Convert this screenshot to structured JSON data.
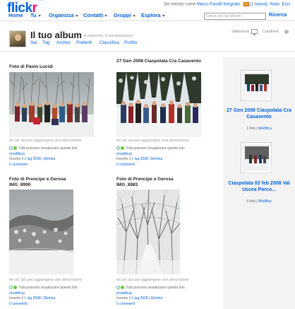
{
  "header": {
    "logo_main": "flick",
    "logo_r": "r",
    "logo_tm": "TM",
    "signed_in_prefix": "Sei entrato come",
    "user": "Marco Favalli fotografo",
    "new_mail": "(1 nuova)",
    "help": "Aiuto",
    "logout": "Esci"
  },
  "nav": {
    "items": [
      "Home",
      "Tu",
      "Organizza",
      "Contatti",
      "Gruppi",
      "Esplora"
    ],
    "search_placeholder": "Cerca nel tuo album",
    "search_button": "Ricerca"
  },
  "album": {
    "title": "Il tuo album",
    "stats": "8 elementi / 0 visualizzazioni",
    "subnav": [
      "Set",
      "Tag",
      "Archivi",
      "Preferiti",
      "Classifica",
      "Profilo"
    ],
    "slideshow": "Slideshow",
    "share": "Condividi"
  },
  "photos": [
    {
      "title": "Foto di Paolo Lucidi",
      "description": "fai clic qui per aggiungere una descrizione",
      "privacy": "Tutti possono visualizzare questa foto",
      "edit": "(modifica)",
      "uploaded_prefix": "Inserito il",
      "date": "1 lug 2008",
      "delete": "Elimina",
      "comments": "0 commenti"
    },
    {
      "title": "27 Gen 2008 Ciaspolata Cra Casavento",
      "description": "fai clic qui per aggiungere una descrizione",
      "privacy": "Tutti possono visualizzare questa foto",
      "edit": "(modifica)",
      "uploaded_prefix": "Inserito il",
      "date": "1 lug 2008",
      "delete": "Elimina",
      "comments": "0 commenti"
    },
    {
      "title": "Foto di Prencipe e Gerosa IMG_8990",
      "description": "fai clic qui per aggiungere una descrizione",
      "privacy": "Tutti possono visualizzare questa foto",
      "edit": "(modifica)",
      "uploaded_prefix": "Inserito il",
      "date": "1 lug 2008",
      "delete": "Elimina",
      "comments": "0 commenti"
    },
    {
      "title": "Foto di Prencipe e Gerosa IMG_8983",
      "description": "fai clic qui per aggiungere una descrizione",
      "privacy": "Tutti possono visualizzare questa foto",
      "edit": "(modifica)",
      "uploaded_prefix": "Inserito il",
      "date": "1 lug 2008",
      "delete": "Elimina",
      "comments": "0 commenti"
    }
  ],
  "sets": [
    {
      "title": "27 Gen 2008 Ciaspolata Cra Casavento",
      "count": "1 foto",
      "edit": "Modifica"
    },
    {
      "title": "Ciaspolata 03 feb 2008 Val Uccea Parco...",
      "count": "6 foto",
      "edit": "Modifica"
    }
  ],
  "colors": {
    "link": "#0063dc",
    "brand_pink": "#ff0084",
    "sidebar_bg": "#f3f3f3"
  }
}
